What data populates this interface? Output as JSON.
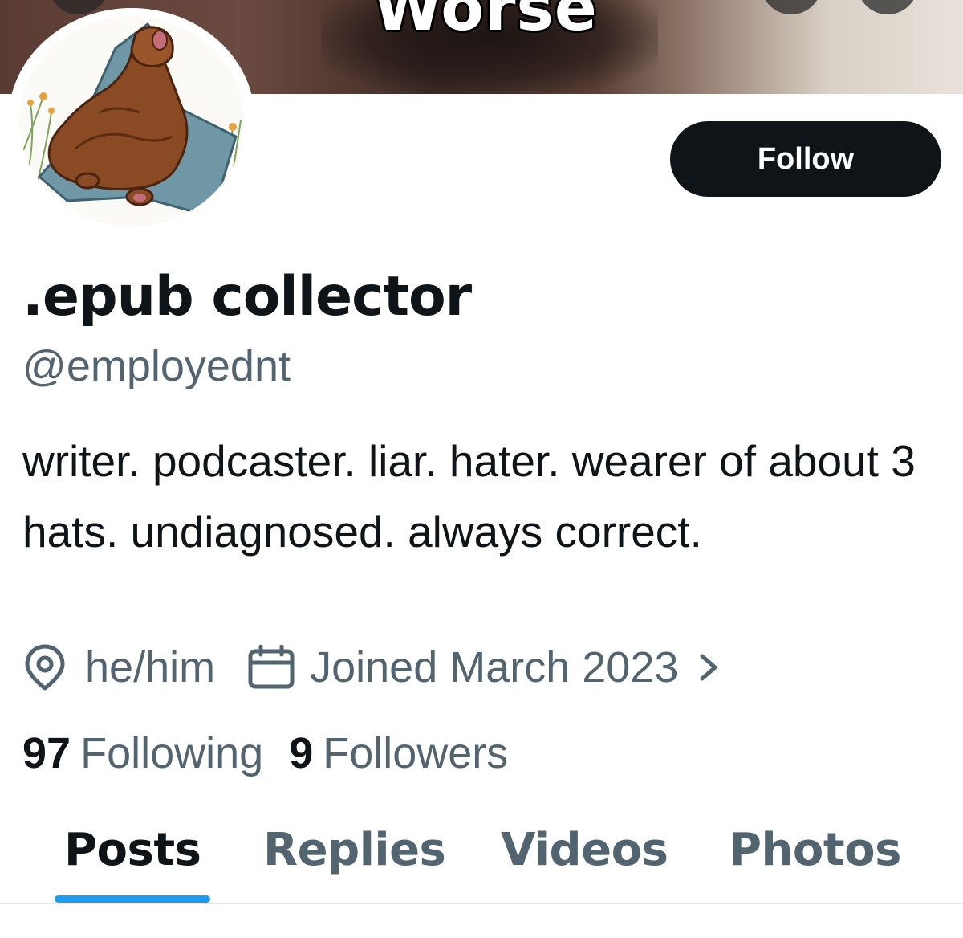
{
  "banner": {
    "caption": "Worse"
  },
  "profile": {
    "display_name": ".epub collector",
    "handle": "@employednt",
    "bio": "writer. podcaster. liar. hater. wearer of about 3 hats. undiagnosed. always correct.",
    "location": "he/him",
    "joined": "Joined March 2023",
    "joined_chevron": "›",
    "following_count": "97",
    "following_label": "Following",
    "followers_count": "9",
    "followers_label": "Followers"
  },
  "actions": {
    "follow_label": "Follow"
  },
  "tabs": [
    {
      "label": "Posts",
      "active": true
    },
    {
      "label": "Replies",
      "active": false
    },
    {
      "label": "Videos",
      "active": false
    },
    {
      "label": "Photos",
      "active": false
    }
  ],
  "icons": {
    "location": "location-pin-icon",
    "calendar": "calendar-icon",
    "chevron": "chevron-right-icon"
  },
  "colors": {
    "text_primary": "#0f1419",
    "text_secondary": "#536471",
    "button_bg": "#0f1419",
    "tab_indicator": "#1d9bf0"
  }
}
